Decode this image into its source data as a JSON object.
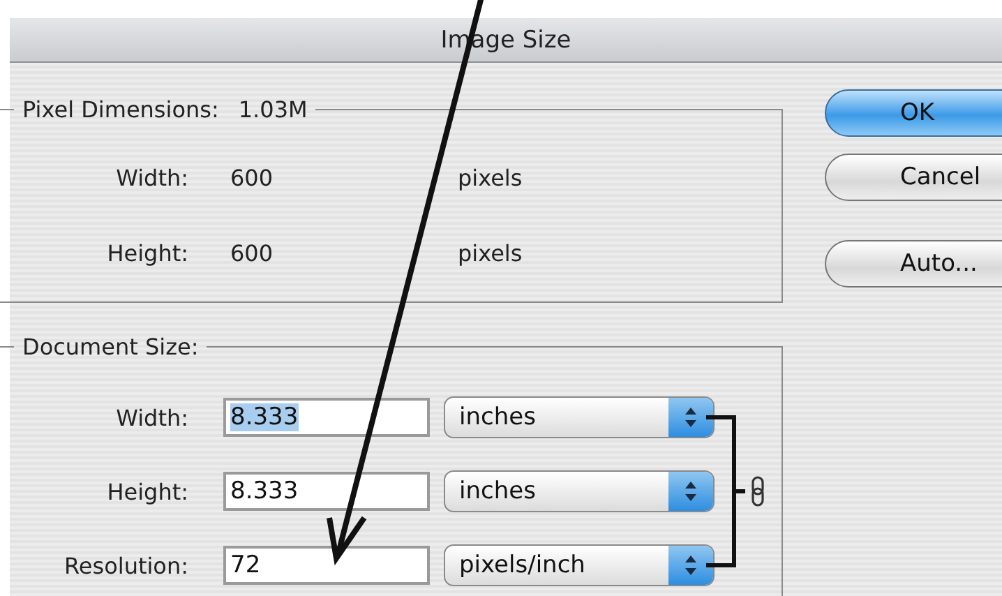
{
  "window": {
    "title": "Image Size"
  },
  "pixel_dimensions": {
    "label": "Pixel Dimensions:",
    "size": "1.03M",
    "rows": [
      {
        "label": "Width:",
        "value": "600",
        "unit": "pixels"
      },
      {
        "label": "Height:",
        "value": "600",
        "unit": "pixels"
      }
    ]
  },
  "document_size": {
    "label": "Document Size:",
    "constrain_proportions": true,
    "rows": [
      {
        "label": "Width:",
        "value": "8.333",
        "text_selected": true,
        "unit": "inches"
      },
      {
        "label": "Height:",
        "value": "8.333",
        "text_selected": false,
        "unit": "inches"
      },
      {
        "label": "Resolution:",
        "value": "72",
        "text_selected": false,
        "unit": "pixels/inch"
      }
    ]
  },
  "buttons": [
    {
      "label": "OK",
      "default": true
    },
    {
      "label": "Cancel",
      "default": false
    },
    {
      "label": "Auto...",
      "default": false
    }
  ]
}
